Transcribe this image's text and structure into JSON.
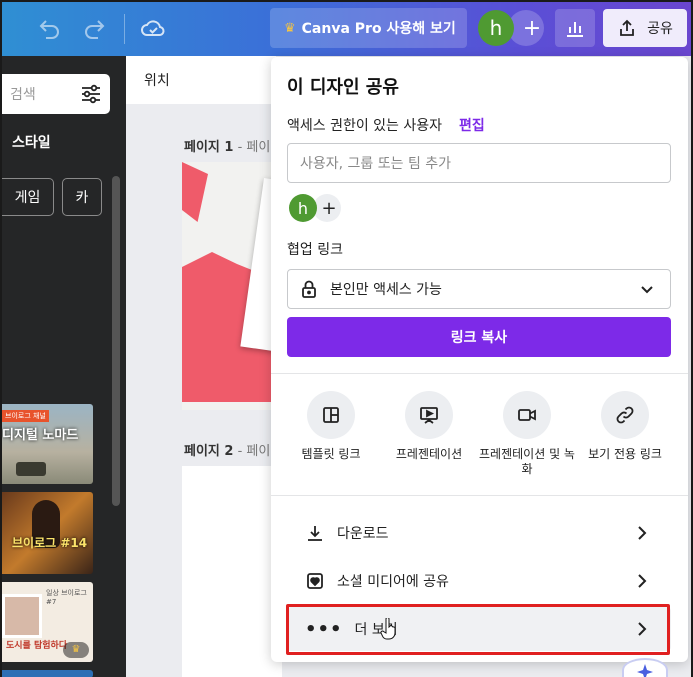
{
  "topbar": {
    "pro_button": "Canva Pro 사용해 보기",
    "avatar_letter": "h",
    "share_label": "공유"
  },
  "left_panel": {
    "search_placeholder": "검색",
    "style_heading": "스타일",
    "chips": [
      "게임",
      "카"
    ],
    "thumbnails": [
      {
        "text": "디지털 노마드",
        "badge": "브이로그 채널"
      },
      {
        "text": "브이로그 #14"
      },
      {
        "text": "도시를 탐험하다",
        "subtitle": "일상 브이로그 #7"
      }
    ]
  },
  "canvas": {
    "header": "위치",
    "pages": [
      {
        "label": "페이지 1",
        "suffix": " - 페이"
      },
      {
        "label": "페이지 2",
        "suffix": " - 페이"
      }
    ]
  },
  "share_panel": {
    "title": "이 디자인 공유",
    "access_label": "액세스 권한이 있는 사용자",
    "edit_link": "편집",
    "input_placeholder": "사용자, 그룹 또는 팀 추가",
    "avatar_letter": "h",
    "collab_label": "협업 링크",
    "access_option": "본인만 액세스 가능",
    "copy_button": "링크 복사",
    "options": [
      {
        "label": "템플릿 링크",
        "icon": "template-icon"
      },
      {
        "label": "프레젠테이션",
        "icon": "presentation-icon"
      },
      {
        "label": "프레젠테이션 및 녹화",
        "icon": "record-icon"
      },
      {
        "label": "보기 전용 링크",
        "icon": "link-icon"
      }
    ],
    "rows": [
      {
        "label": "다운로드",
        "icon": "download-icon"
      },
      {
        "label": "소셜 미디어에 공유",
        "icon": "heart-icon"
      },
      {
        "label": "더 보기",
        "icon": "more-icon"
      }
    ]
  },
  "colors": {
    "accent": "#7d2ae8",
    "highlight_border": "#e02020",
    "avatar_green": "#4f9a32"
  }
}
